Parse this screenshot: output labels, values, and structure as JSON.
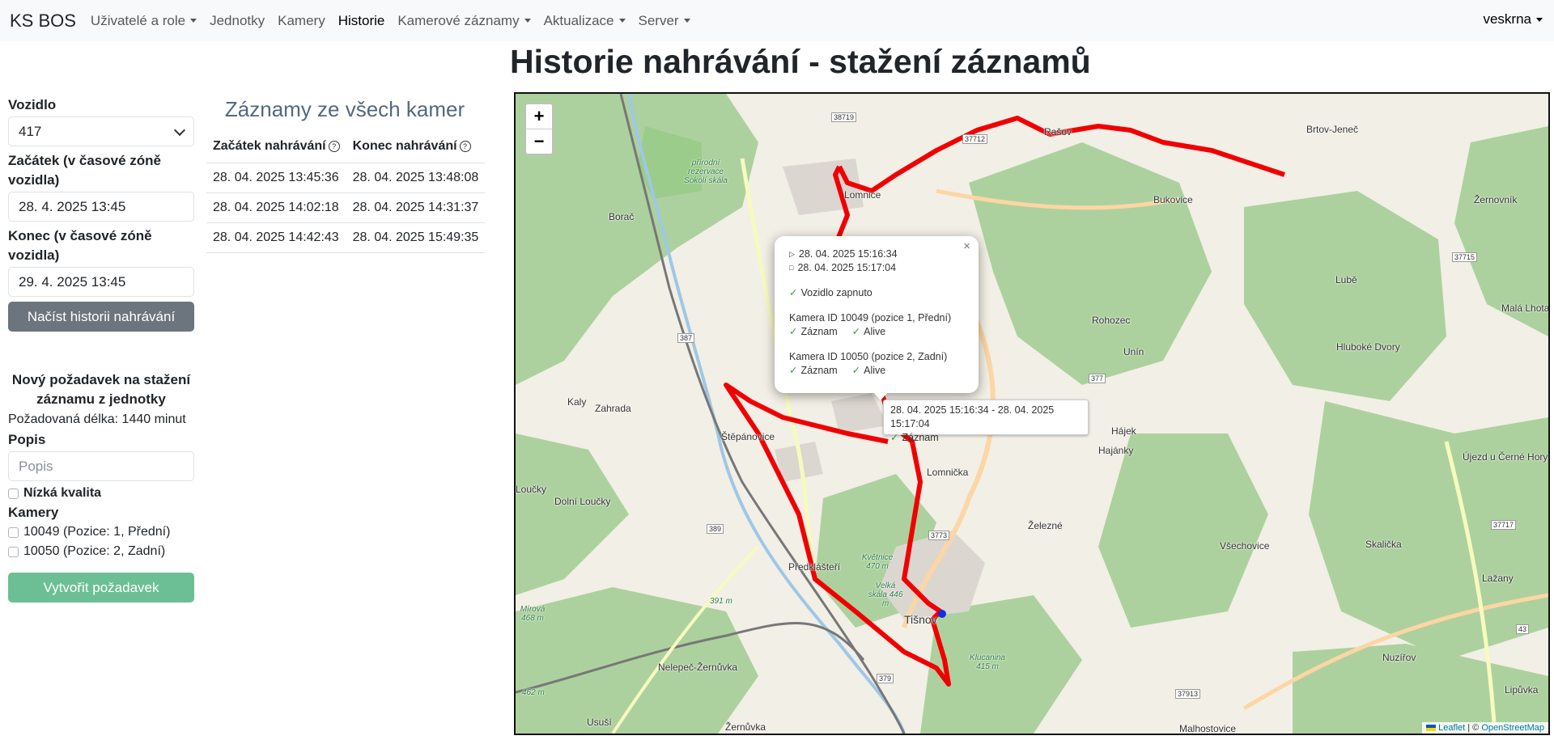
{
  "nav": {
    "brand": "KS BOS",
    "items": [
      {
        "label": "Uživatelé a role",
        "dropdown": true
      },
      {
        "label": "Jednotky",
        "dropdown": false
      },
      {
        "label": "Kamery",
        "dropdown": false
      },
      {
        "label": "Historie",
        "dropdown": false,
        "active": true
      },
      {
        "label": "Kamerové záznamy",
        "dropdown": true
      },
      {
        "label": "Aktualizace",
        "dropdown": true
      },
      {
        "label": "Server",
        "dropdown": true
      }
    ],
    "user": "veskrna"
  },
  "page_title": "Historie nahrávání - stažení záznamů",
  "form": {
    "vehicle_label": "Vozidlo",
    "vehicle_value": "417",
    "start_label": "Začátek (v časové zóně vozidla)",
    "start_value": "28. 4. 2025 13:45",
    "end_label": "Konec (v časové zóně vozidla)",
    "end_value": "29. 4. 2025 13:45",
    "load_button": "Načíst historii nahrávání",
    "request_title": "Nový požadavek na stažení záznamu z jednotky",
    "length_text": "Požadovaná délka: 1440 minut",
    "desc_label": "Popis",
    "desc_placeholder": "Popis",
    "low_quality_label": "Nízká kvalita",
    "cameras_label": "Kamery",
    "cameras": [
      "10049 (Pozice: 1, Přední)",
      "10050 (Pozice: 2, Zadní)"
    ],
    "create_button": "Vytvořit požadavek"
  },
  "recordings": {
    "title": "Záznamy ze všech kamer",
    "columns": [
      "Začátek nahrávání",
      "Konec nahrávání"
    ],
    "rows": [
      [
        "28. 04. 2025 13:45:36",
        "28. 04. 2025 13:48:08"
      ],
      [
        "28. 04. 2025 14:02:18",
        "28. 04. 2025 14:31:37"
      ],
      [
        "28. 04. 2025 14:42:43",
        "28. 04. 2025 15:49:35"
      ]
    ]
  },
  "map": {
    "zoom_in": "+",
    "zoom_out": "−",
    "popup": {
      "start": "28. 04. 2025 15:16:34",
      "end": "28. 04. 2025 15:17:04",
      "vehicle_on": "Vozidlo zapnuto",
      "camera1": "Kamera ID 10049 (pozice 1, Přední)",
      "camera2": "Kamera ID 10050 (pozice 2, Zadní)",
      "rec": "Záznam",
      "alive": "Alive"
    },
    "tooltip": {
      "range": "28. 04. 2025 15:16:34 - 28. 04. 2025 15:17:04",
      "rec": "Záznam"
    },
    "places": [
      "Brtov-Jeneč",
      "Rašov",
      "Lomnice",
      "Bukovice",
      "Žernovník",
      "Lubě",
      "Malá Lhota",
      "Rohozec",
      "Unín",
      "Hluboké Dvory",
      "Borač",
      "Kaly",
      "Zahrada",
      "Štěpánovice",
      "Lomnička",
      "Hájek",
      "Hajánky",
      "Újezd u Černé Hory",
      "Dolní Loučky",
      "Železné",
      "Všechovice",
      "Skalička",
      "Lažany",
      "Předklášteří",
      "Tišnov",
      "Nelepeč-Žernůvka",
      "Nuzířov",
      "Lipůvka",
      "Usuší",
      "Žernůvka",
      "Malhostovice",
      "Loučky"
    ],
    "nature": [
      "přírodní rezervace Sokolí skála",
      "Květnice 470 m",
      "Velká skála 446 m",
      "Klucanina 415 m",
      "Mírová 468 m",
      "391 m",
      "462 m"
    ],
    "roads": [
      "38719",
      "37712",
      "37715",
      "387",
      "377",
      "389",
      "3773",
      "37717",
      "43",
      "379",
      "37913"
    ],
    "attribution": {
      "leaflet": "Leaflet",
      "sep": " | © ",
      "osm": "OpenStreetMap"
    }
  }
}
